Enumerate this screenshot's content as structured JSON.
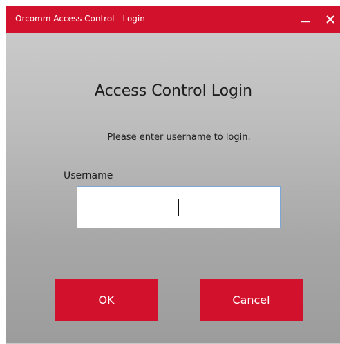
{
  "window": {
    "title": "Orcomm Access Control - Login",
    "accent_color": "#d2112d"
  },
  "titlebar_buttons": {
    "minimize_icon": "minimize-icon",
    "close_icon": "close-icon"
  },
  "login": {
    "heading": "Access Control Login",
    "instruction": "Please enter username to login.",
    "username_label": "Username",
    "username_value": ""
  },
  "buttons": {
    "ok_label": "OK",
    "cancel_label": "Cancel"
  }
}
